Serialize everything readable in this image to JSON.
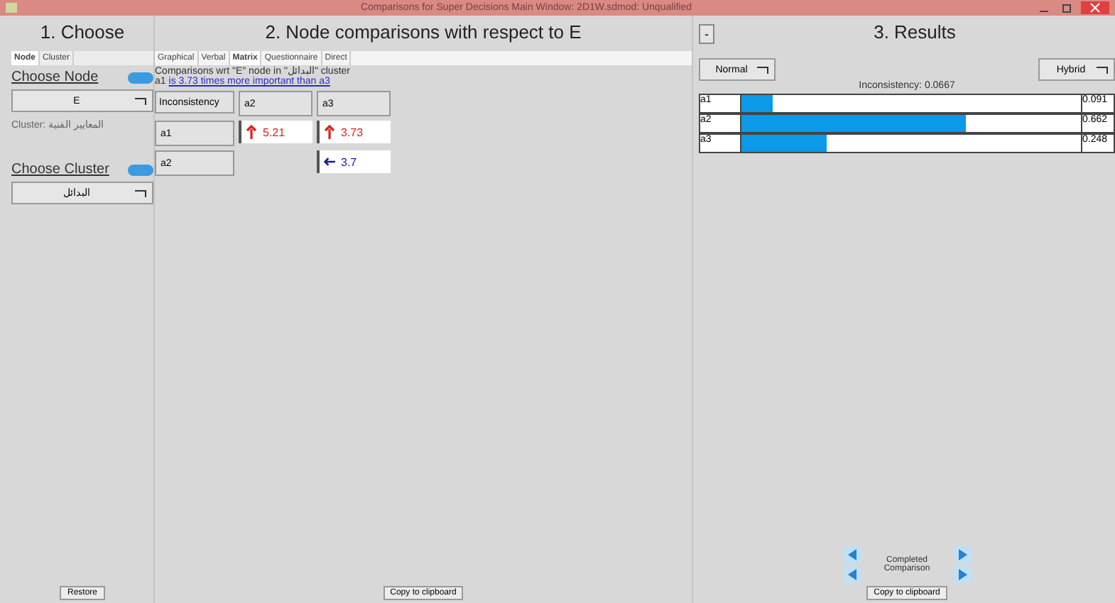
{
  "window": {
    "title": "Comparisons for Super Decisions Main Window: 2D1W.sdmod: Unqualified"
  },
  "choose": {
    "heading": "1. Choose",
    "tabs": [
      {
        "label": "Node",
        "selected": true
      },
      {
        "label": "Cluster",
        "selected": false
      }
    ],
    "node_label": "Choose Node",
    "node_value": "E",
    "cluster_caption": "Cluster: المعايير الفنية",
    "cluster_label": "Choose Cluster",
    "cluster_value": "البدائل",
    "restore": "Restore"
  },
  "comparisons": {
    "heading": "2. Node comparisons with respect to E",
    "tabs": [
      {
        "label": "Graphical",
        "selected": false
      },
      {
        "label": "Verbal",
        "selected": false
      },
      {
        "label": "Matrix",
        "selected": true
      },
      {
        "label": "Questionnaire",
        "selected": false
      },
      {
        "label": "Direct",
        "selected": false
      }
    ],
    "caption": "Comparisons wrt \"E\" node in \"البدائل\" cluster",
    "hint_prefix": "a1",
    "hint_link": "is 3.73 times more important than a3",
    "corner": "Inconsistency",
    "columns": [
      "a2",
      "a3"
    ],
    "rows": [
      {
        "label": "a1",
        "cells": [
          {
            "kind": "up",
            "value": "5.21"
          },
          {
            "kind": "up",
            "value": "3.73"
          }
        ]
      },
      {
        "label": "a2",
        "cells": [
          null,
          {
            "kind": "left",
            "value": "3.7"
          }
        ]
      }
    ],
    "copy": "Copy to clipboard"
  },
  "results": {
    "heading": "3. Results",
    "collapse": "-",
    "mode": "Normal",
    "view": "Hybrid",
    "inconsistency": "Inconsistency: 0.0667",
    "rows": [
      {
        "label": "a1",
        "level": 0.09,
        "value": "0.091"
      },
      {
        "label": "a2",
        "level": 0.66,
        "value": "0.662"
      },
      {
        "label": "a3",
        "level": 0.25,
        "value": "0.248"
      }
    ],
    "completed": "Completed Comparison",
    "copy": "Copy to clipboard"
  }
}
